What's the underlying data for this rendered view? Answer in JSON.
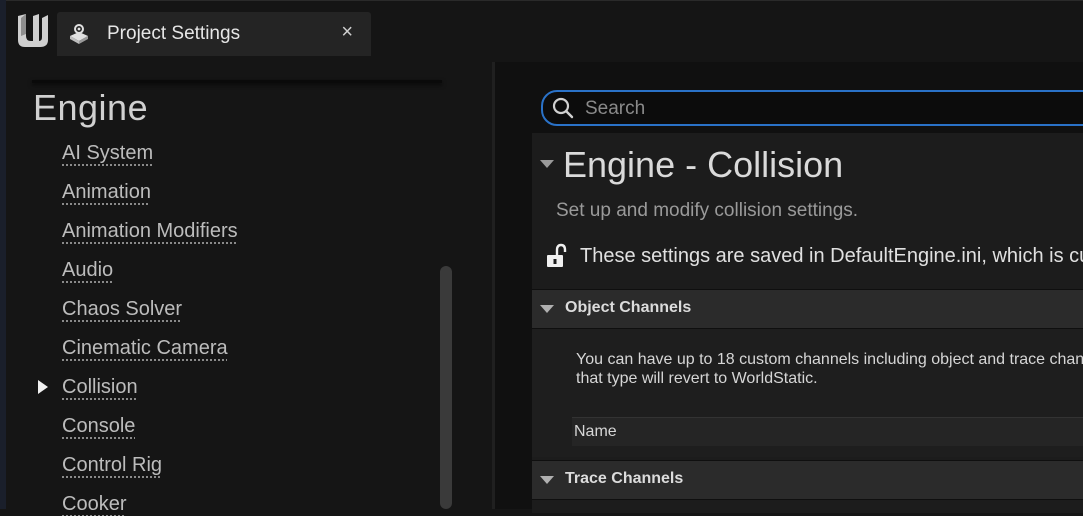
{
  "window": {
    "tab_title": "Project Settings",
    "tab_close": "×"
  },
  "sidebar": {
    "section_heading": "Engine",
    "selected_index": 6,
    "items": [
      {
        "label": "AI System"
      },
      {
        "label": "Animation"
      },
      {
        "label": "Animation Modifiers"
      },
      {
        "label": "Audio"
      },
      {
        "label": "Chaos Solver"
      },
      {
        "label": "Cinematic Camera"
      },
      {
        "label": "Collision"
      },
      {
        "label": "Console"
      },
      {
        "label": "Control Rig"
      },
      {
        "label": "Cooker"
      }
    ]
  },
  "search": {
    "placeholder": "Search",
    "value": ""
  },
  "details": {
    "title": "Engine - Collision",
    "description": "Set up and modify collision settings.",
    "config_note": "These settings are saved in DefaultEngine.ini, which is cu",
    "groups": [
      {
        "label": "Object Channels"
      },
      {
        "label": "Trace Channels"
      }
    ],
    "object_channels_text_line1": "You can have up to 18 custom channels including object and trace chan",
    "object_channels_text_line2": "that type will revert to WorldStatic.",
    "column_name": "Name"
  },
  "icons": {
    "logo": "unreal-engine-logo-icon",
    "settings": "settings-cube-icon",
    "search": "search-icon",
    "lock": "unlocked-padlock-icon"
  },
  "colors": {
    "accent": "#2a72c8",
    "background": "#151515",
    "panel": "#1c1c1c",
    "group_header": "#2b2b2b"
  }
}
